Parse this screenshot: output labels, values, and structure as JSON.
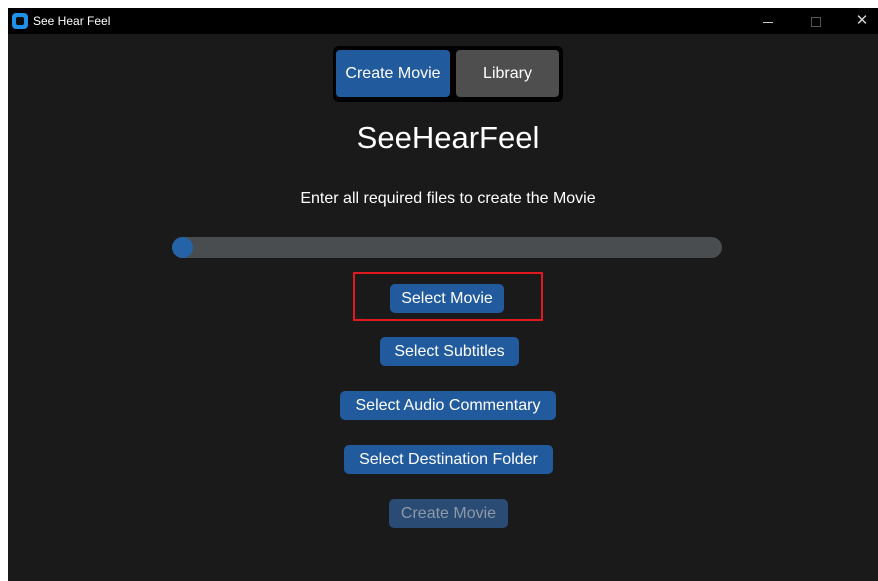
{
  "window": {
    "title": "See Hear Feel",
    "controls": {
      "minimize": "",
      "maximize": "",
      "close": "✕"
    }
  },
  "tabs": [
    {
      "label": "Create Movie",
      "selected": true
    },
    {
      "label": "Library",
      "selected": false
    }
  ],
  "main": {
    "title": "SeeHearFeel",
    "instruction": "Enter all required files to create the Movie",
    "progress": 0
  },
  "buttons": {
    "select_movie": "Select Movie",
    "select_subtitles": "Select Subtitles",
    "select_audio": "Select Audio Commentary",
    "select_destination": "Select Destination Folder",
    "create_movie": "Create Movie"
  },
  "colors": {
    "accent": "#225a9e",
    "background": "#1a1a1a",
    "highlight": "#e0191e"
  }
}
